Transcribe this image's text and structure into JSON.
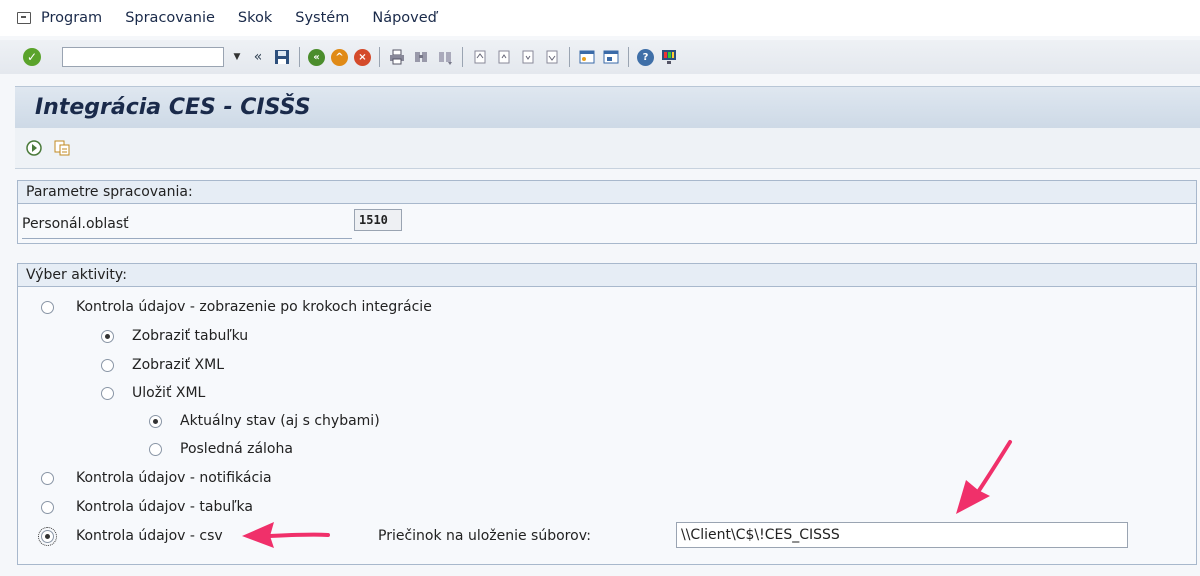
{
  "menu": {
    "items": [
      {
        "label": "Program"
      },
      {
        "label": "Spracovanie"
      },
      {
        "label": "Skok"
      },
      {
        "label": "Systém"
      },
      {
        "label": "Nápoveď"
      }
    ]
  },
  "toolbar": {
    "command_field_value": ""
  },
  "screen": {
    "title": "Integrácia CES - CISŠS"
  },
  "params": {
    "group_title": "Parametre spracovania:",
    "personal_area_label": "Personál.oblasť",
    "personal_area_value": "1510"
  },
  "activity": {
    "group_title": "Výber aktivity:",
    "options": [
      {
        "label": "Kontrola údajov - zobrazenie po krokoch integrácie",
        "selected": false
      },
      {
        "label": "Zobraziť tabuľku",
        "selected": true
      },
      {
        "label": "Zobraziť XML",
        "selected": false
      },
      {
        "label": "Uložiť XML",
        "selected": false
      },
      {
        "label": "Aktuálny stav (aj s chybami)",
        "selected": true
      },
      {
        "label": "Posledná záloha",
        "selected": false
      },
      {
        "label": "Kontrola údajov - notifikácia",
        "selected": false
      },
      {
        "label": "Kontrola údajov - tabuľka",
        "selected": false
      },
      {
        "label": "Kontrola údajov - csv",
        "selected": true
      }
    ],
    "folder_label": "Priečinok na uloženie súborov:",
    "folder_value": "\\\\Client\\C$\\!CES_CISSS"
  },
  "colors": {
    "annotation_arrow": "#f0306a",
    "check_green": "#5aa32b"
  }
}
